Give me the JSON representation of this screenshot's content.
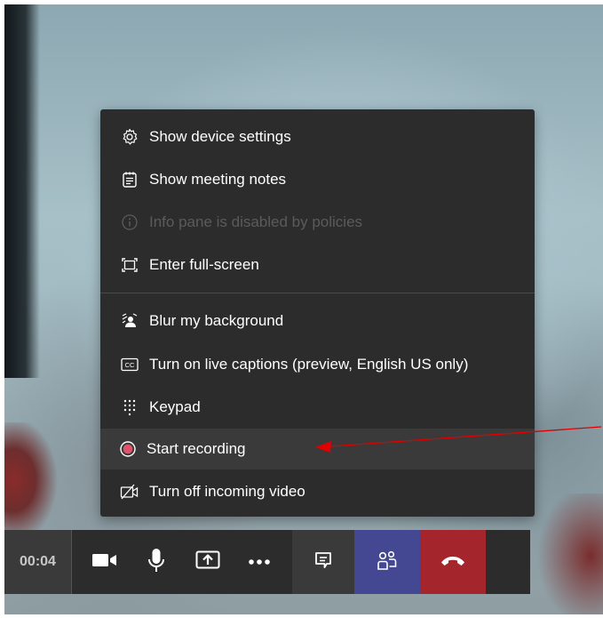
{
  "menu": {
    "items": [
      {
        "label": "Show device settings",
        "icon": "gear-icon",
        "enabled": true
      },
      {
        "label": "Show meeting notes",
        "icon": "notes-icon",
        "enabled": true
      },
      {
        "label": "Info pane is disabled by policies",
        "icon": "info-icon",
        "enabled": false
      },
      {
        "label": "Enter full-screen",
        "icon": "fullscreen-icon",
        "enabled": true
      },
      {
        "label": "Blur my background",
        "icon": "blur-background-icon",
        "enabled": true
      },
      {
        "label": "Turn on live captions (preview, English US only)",
        "icon": "captions-icon",
        "enabled": true
      },
      {
        "label": "Keypad",
        "icon": "keypad-icon",
        "enabled": true
      },
      {
        "label": "Start recording",
        "icon": "record-icon",
        "enabled": true,
        "highlighted": true
      },
      {
        "label": "Turn off incoming video",
        "icon": "video-off-icon",
        "enabled": true
      }
    ]
  },
  "toolbar": {
    "timer": "00:04",
    "buttons": [
      {
        "icon": "camera-icon"
      },
      {
        "icon": "microphone-icon"
      },
      {
        "icon": "share-screen-icon"
      },
      {
        "icon": "more-options-icon"
      },
      {
        "icon": "chat-icon"
      },
      {
        "icon": "participants-icon"
      },
      {
        "icon": "hang-up-icon"
      }
    ]
  },
  "colors": {
    "menu_bg": "#2d2c2c",
    "highlight_bg": "#3b3a3a",
    "record_dot": "#e0526a",
    "people_button": "#444791",
    "hang_up_button": "#a4262c",
    "annotation_arrow": "#e00000"
  }
}
